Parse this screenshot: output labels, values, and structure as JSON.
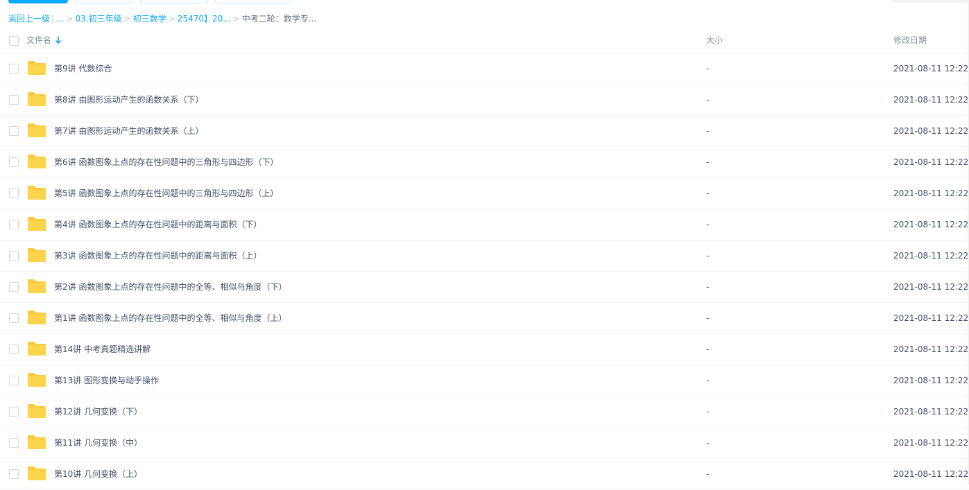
{
  "breadcrumb": {
    "back": "返回上一级",
    "ellipsis": "...",
    "items": [
      "03.初三年级",
      "初三数学",
      "25470】20...",
      "中考二轮：数学专..."
    ]
  },
  "header": {
    "name": "文件名",
    "size": "大小",
    "date": "修改日期"
  },
  "colors": {
    "accent": "#09aaff",
    "folder": "#ffd44d"
  },
  "rows": [
    {
      "name": "第9讲 代数综合",
      "size": "-",
      "date": "2021-08-11 12:22"
    },
    {
      "name": "第8讲 由图形运动产生的函数关系（下）",
      "size": "-",
      "date": "2021-08-11 12:22"
    },
    {
      "name": "第7讲 由图形运动产生的函数关系（上）",
      "size": "-",
      "date": "2021-08-11 12:22"
    },
    {
      "name": "第6讲 函数图象上点的存在性问题中的三角形与四边形（下）",
      "size": "-",
      "date": "2021-08-11 12:22"
    },
    {
      "name": "第5讲 函数图象上点的存在性问题中的三角形与四边形（上）",
      "size": "-",
      "date": "2021-08-11 12:22"
    },
    {
      "name": "第4讲 函数图象上点的存在性问题中的距离与面积（下）",
      "size": "-",
      "date": "2021-08-11 12:22"
    },
    {
      "name": "第3讲 函数图象上点的存在性问题中的距离与面积（上）",
      "size": "-",
      "date": "2021-08-11 12:22"
    },
    {
      "name": "第2讲 函数图象上点的存在性问题中的全等、相似与角度（下）",
      "size": "-",
      "date": "2021-08-11 12:22"
    },
    {
      "name": "第1讲 函数图象上点的存在性问题中的全等、相似与角度（上）",
      "size": "-",
      "date": "2021-08-11 12:22"
    },
    {
      "name": "第14讲 中考真题精选讲解",
      "size": "-",
      "date": "2021-08-11 12:22"
    },
    {
      "name": "第13讲 图形变换与动手操作",
      "size": "-",
      "date": "2021-08-11 12:22"
    },
    {
      "name": "第12讲 几何变换（下）",
      "size": "-",
      "date": "2021-08-11 12:22"
    },
    {
      "name": "第11讲 几何变换（中）",
      "size": "-",
      "date": "2021-08-11 12:22"
    },
    {
      "name": "第10讲 几何变换（上）",
      "size": "-",
      "date": "2021-08-11 12:22"
    }
  ]
}
